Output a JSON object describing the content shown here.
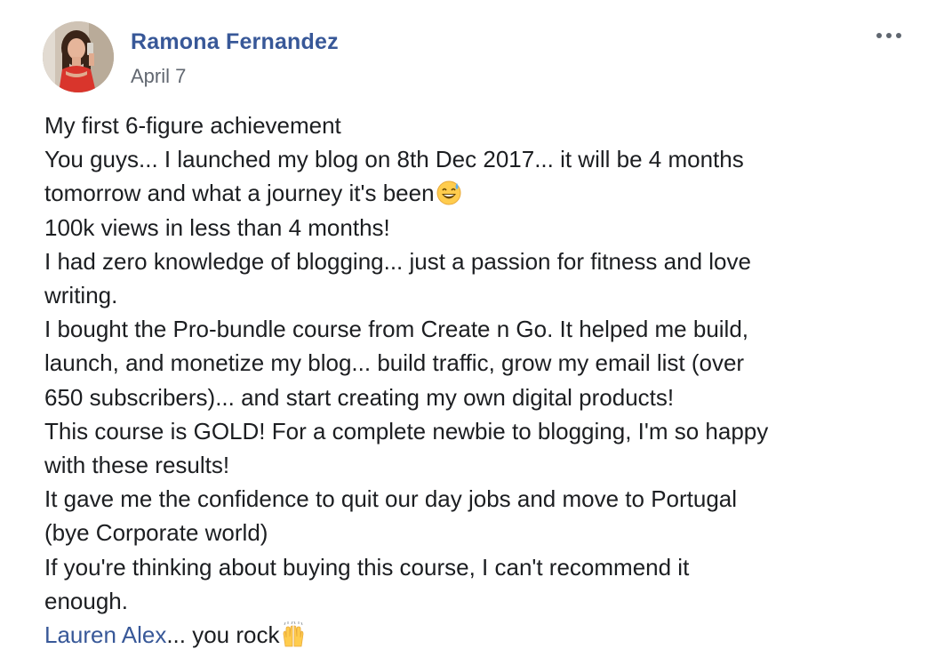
{
  "post": {
    "author": "Ramona Fernandez",
    "date": "April 7",
    "more_menu_icon": "more-horizontal-icon",
    "lines": [
      "My first 6-figure achievement",
      "You guys... I launched my blog on 8th Dec 2017... it will be 4 months",
      "tomorrow and what a journey it's been",
      "100k views in less than 4 months!",
      "I had zero knowledge of blogging... just a passion for fitness and love",
      "writing.",
      "I bought the Pro-bundle course from Create n Go. It helped me build,",
      "launch, and monetize my blog... build traffic, grow my email list (over",
      "650 subscribers)... and start creating my own digital products!",
      "This course is GOLD! For a complete newbie to blogging, I'm so happy",
      "with these results!",
      "It gave me the confidence to quit our day jobs and move to Portugal",
      "(bye Corporate world)",
      "If you're thinking about buying this course, I can't recommend it",
      "enough."
    ],
    "closing": {
      "mention": "Lauren Alex",
      "text": "... you rock"
    },
    "emojis": {
      "sweat_smile": "grinning-sweat-emoji",
      "raised_hands": "raising-hands-emoji"
    },
    "colors": {
      "link": "#385898",
      "text": "#1c1e21",
      "meta": "#616770"
    }
  }
}
